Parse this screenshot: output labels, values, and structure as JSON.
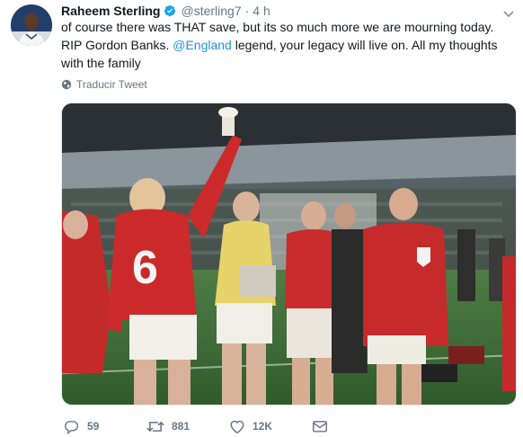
{
  "tweet": {
    "author_name": "Raheem Sterling",
    "handle": "@sterling7",
    "separator": "·",
    "time": "4 h",
    "text_before": "of course there was THAT save, but its so much more we are mourning today. RIP Gordon Banks. ",
    "mention": "@England",
    "text_after": " legend, your legacy will live on. All my thoughts with the family",
    "translate_label": "Traducir Tweet",
    "counts": {
      "replies": "59",
      "retweets": "881",
      "likes": "12K"
    },
    "photo": {
      "shirt_number": "6"
    }
  },
  "colors": {
    "link": "#1b95e0",
    "secondary_text": "#657786",
    "verified": "#1da1f2"
  },
  "icons": [
    "verified-badge-icon",
    "caret-down-icon",
    "globe-icon",
    "reply-icon",
    "retweet-icon",
    "like-icon",
    "direct-message-icon"
  ]
}
